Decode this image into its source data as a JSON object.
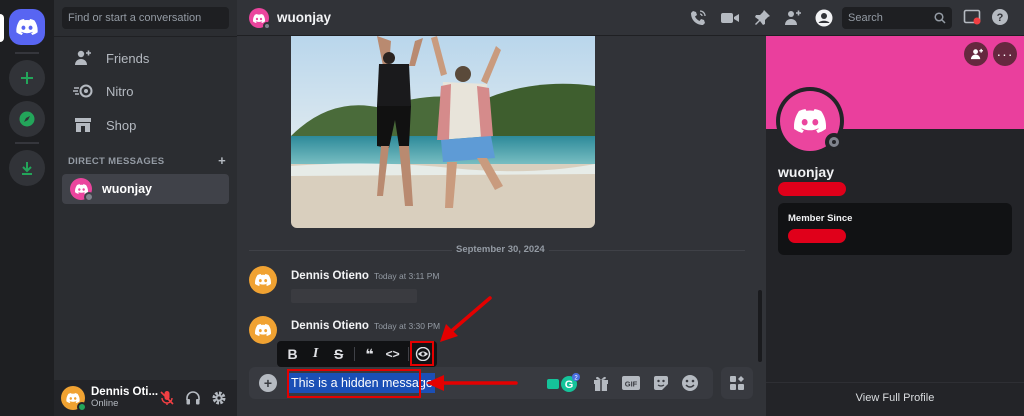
{
  "sidebar": {
    "search_placeholder": "Find or start a conversation",
    "nav": [
      {
        "label": "Friends",
        "icon": "friends-icon"
      },
      {
        "label": "Nitro",
        "icon": "nitro-icon"
      },
      {
        "label": "Shop",
        "icon": "shop-icon"
      }
    ],
    "dm_header": "DIRECT MESSAGES",
    "dm_add": "+",
    "dms": [
      {
        "name": "wuonjay",
        "avatar_color": "#eb459e"
      }
    ]
  },
  "user_panel": {
    "name": "Dennis Oti...",
    "status": "Online",
    "avatar_color": "#f0a232"
  },
  "header": {
    "title": "wuonjay",
    "search_placeholder": "Search"
  },
  "chat": {
    "date_divider": "September 30, 2024",
    "messages": [
      {
        "author": "Dennis Otieno",
        "time": "Today at 3:11 PM",
        "avatar_color": "#f0a232"
      },
      {
        "author": "Dennis Otieno",
        "time": "Today at 3:30 PM",
        "avatar_color": "#f0a232"
      }
    ]
  },
  "format_toolbar": {
    "bold": "B",
    "italic": "I",
    "strike": "S",
    "quote": "❝",
    "code": "<>"
  },
  "composer": {
    "text": "This is a hidden message",
    "badge_count": "2"
  },
  "profile": {
    "name": "wuonjay",
    "member_since_label": "Member Since",
    "view_full": "View Full Profile",
    "banner_color": "#ea3f9d"
  },
  "colors": {
    "accent": "#5865f2",
    "annotation": "#e40000",
    "online": "#23a55a"
  }
}
